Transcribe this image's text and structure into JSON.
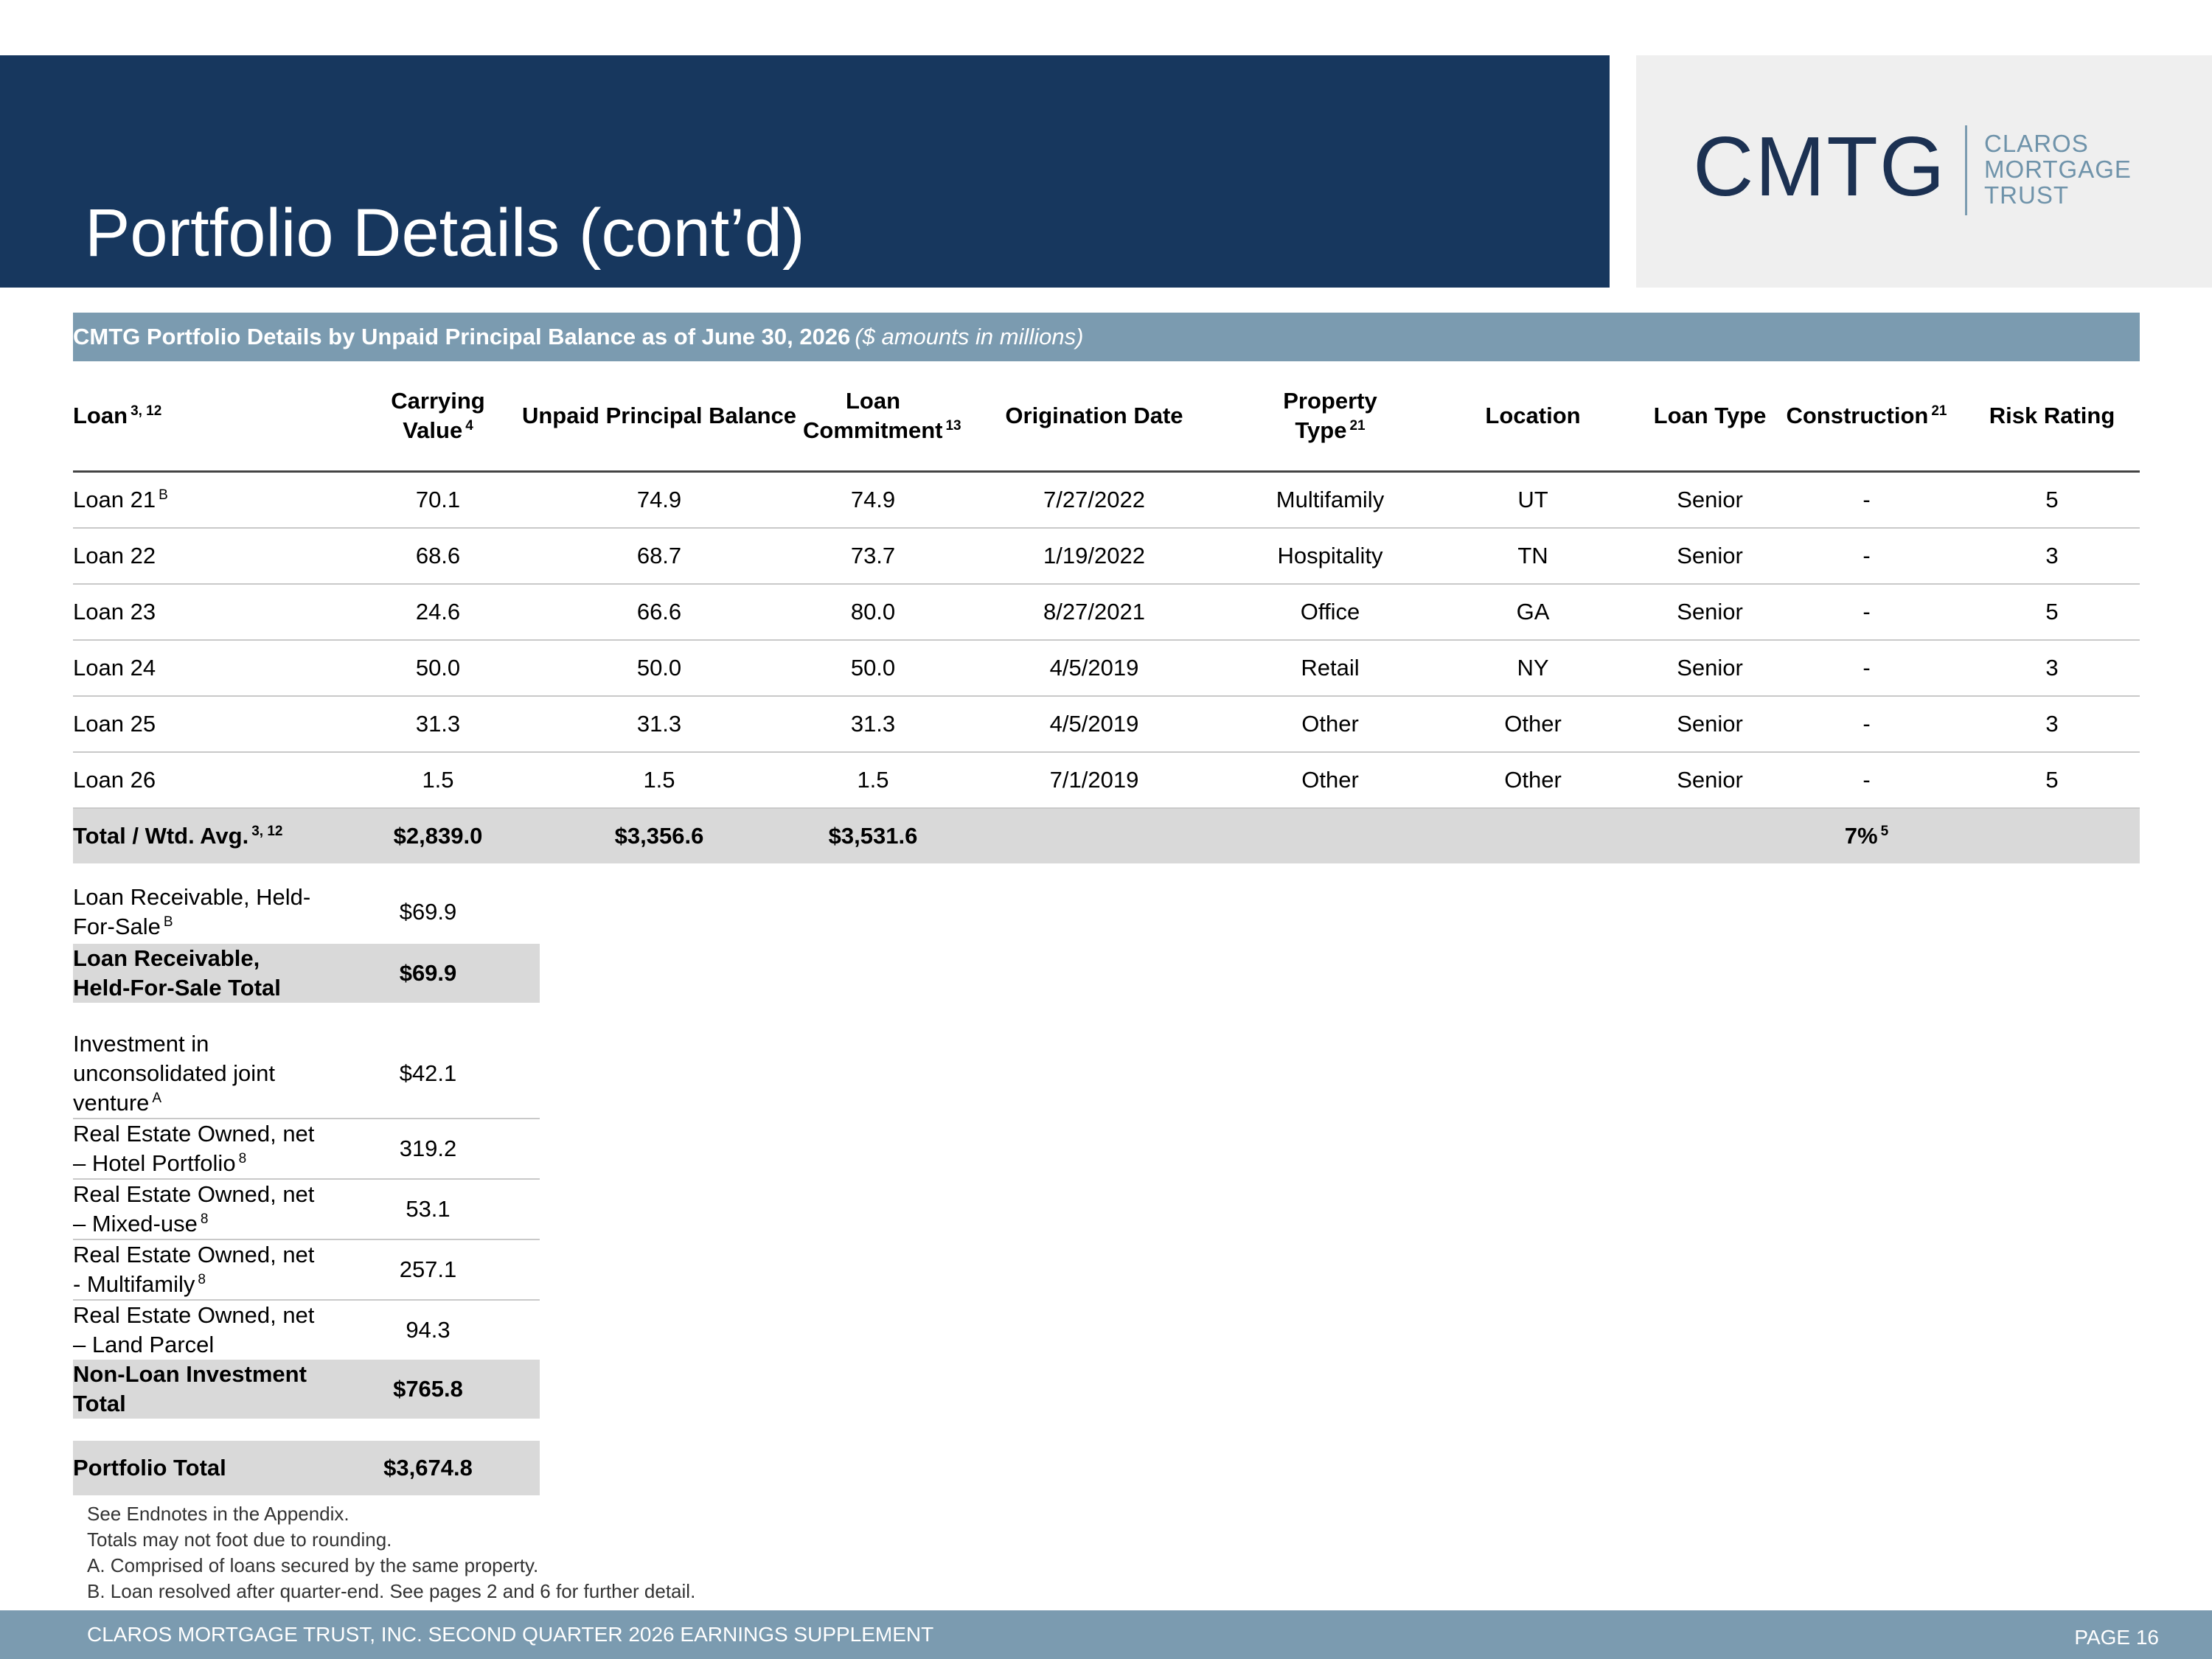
{
  "header": {
    "title": "Portfolio Details (cont’d)"
  },
  "logo": {
    "mark": "CMTG",
    "words": [
      "CLAROS",
      "MORTGAGE",
      "TRUST"
    ]
  },
  "table": {
    "banner_title": "CMTG Portfolio Details by Unpaid Principal Balance as of June 30, 2026",
    "banner_units": "($ amounts in millions)",
    "columns": [
      {
        "label": "Loan",
        "sup": "3, 12"
      },
      {
        "label": "Carrying Value",
        "sup": "4"
      },
      {
        "label": "Unpaid Principal Balance",
        "sup": ""
      },
      {
        "label": "Loan Commitment",
        "sup": "13"
      },
      {
        "label": "Origination Date",
        "sup": ""
      },
      {
        "label": "Property Type",
        "sup": "21"
      },
      {
        "label": "Location",
        "sup": ""
      },
      {
        "label": "Loan Type",
        "sup": ""
      },
      {
        "label": "Construction",
        "sup": "21"
      },
      {
        "label": "Risk Rating",
        "sup": ""
      }
    ],
    "rows": [
      {
        "loan": "Loan 21",
        "sup": "B",
        "carrying": "70.1",
        "upb": "74.9",
        "commitment": "74.9",
        "date": "7/27/2022",
        "property": "Multifamily",
        "location": "UT",
        "type": "Senior",
        "construction": "-",
        "risk": "5"
      },
      {
        "loan": "Loan 22",
        "sup": "",
        "carrying": "68.6",
        "upb": "68.7",
        "commitment": "73.7",
        "date": "1/19/2022",
        "property": "Hospitality",
        "location": "TN",
        "type": "Senior",
        "construction": "-",
        "risk": "3"
      },
      {
        "loan": "Loan 23",
        "sup": "",
        "carrying": "24.6",
        "upb": "66.6",
        "commitment": "80.0",
        "date": "8/27/2021",
        "property": "Office",
        "location": "GA",
        "type": "Senior",
        "construction": "-",
        "risk": "5"
      },
      {
        "loan": "Loan 24",
        "sup": "",
        "carrying": "50.0",
        "upb": "50.0",
        "commitment": "50.0",
        "date": "4/5/2019",
        "property": "Retail",
        "location": "NY",
        "type": "Senior",
        "construction": "-",
        "risk": "3"
      },
      {
        "loan": "Loan 25",
        "sup": "",
        "carrying": "31.3",
        "upb": "31.3",
        "commitment": "31.3",
        "date": "4/5/2019",
        "property": "Other",
        "location": "Other",
        "type": "Senior",
        "construction": "-",
        "risk": "3"
      },
      {
        "loan": "Loan 26",
        "sup": "",
        "carrying": "1.5",
        "upb": "1.5",
        "commitment": "1.5",
        "date": "7/1/2019",
        "property": "Other",
        "location": "Other",
        "type": "Senior",
        "construction": "-",
        "risk": "5"
      }
    ],
    "total": {
      "label": "Total / Wtd. Avg.",
      "sup": "3, 12",
      "carrying": "$2,839.0",
      "upb": "$3,356.6",
      "commitment": "$3,531.6",
      "construction": "7%",
      "construction_sup": "5"
    }
  },
  "held_for_sale": {
    "rows": [
      {
        "label": "Loan Receivable, Held-For-Sale",
        "sup": "B",
        "value": "$69.9"
      }
    ],
    "total": {
      "label": "Loan Receivable, Held-For-Sale Total",
      "value": "$69.9"
    }
  },
  "non_loan": {
    "rows": [
      {
        "label": "Investment in unconsolidated joint venture",
        "sup": "A",
        "value": "$42.1"
      },
      {
        "label": "Real Estate Owned, net – Hotel Portfolio",
        "sup": "8",
        "value": "319.2"
      },
      {
        "label": "Real Estate Owned, net – Mixed-use",
        "sup": "8",
        "value": "53.1"
      },
      {
        "label": "Real Estate Owned, net - Multifamily",
        "sup": "8",
        "value": "257.1"
      },
      {
        "label": "Real Estate Owned, net – Land Parcel",
        "sup": "",
        "value": "94.3"
      }
    ],
    "total": {
      "label": "Non-Loan Investment Total",
      "value": "$765.8"
    }
  },
  "portfolio_total": {
    "label": "Portfolio Total",
    "value": "$3,674.8"
  },
  "notes": [
    "See Endnotes in the Appendix.",
    "Totals may not foot due to rounding.",
    "A. Comprised of loans secured by the same property.",
    "B. Loan resolved after quarter-end. See pages 2 and 6 for further detail."
  ],
  "footer": {
    "text": "CLAROS MORTGAGE TRUST, INC. SECOND QUARTER 2026 EARNINGS SUPPLEMENT",
    "page": "PAGE 16"
  },
  "colors": {
    "navy": "#17375e",
    "steel_blue": "#7b9bb0",
    "row_shade": "#d9d9d9",
    "logo_bg": "#efefef"
  }
}
